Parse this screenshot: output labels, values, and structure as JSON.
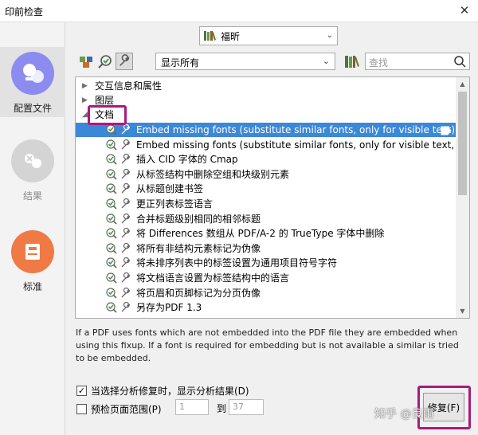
{
  "window": {
    "title": "印前检查",
    "close_glyph": "✕"
  },
  "nav": {
    "items": [
      {
        "label": "配置文件",
        "icon": "profile-icon",
        "color": "#8c8cf0",
        "active": true
      },
      {
        "label": "结果",
        "icon": "results-icon",
        "color": "#d4d4d4",
        "active": false
      },
      {
        "label": "标准",
        "icon": "standards-icon",
        "color": "#f07a45",
        "active": false
      }
    ]
  },
  "profile": {
    "selected": "福昕"
  },
  "toolbar": {
    "filter_value": "显示所有",
    "search_placeholder": "查找"
  },
  "tree": {
    "groups": [
      {
        "label": "交互信息和属性",
        "expanded": false
      },
      {
        "label": "图层",
        "expanded": false
      },
      {
        "label": "文档",
        "expanded": true
      }
    ],
    "items": [
      {
        "label": "Embed missing fonts (substitute similar fonts, only for visible text)",
        "selected": true
      },
      {
        "label": "Embed missing fonts (substitute similar fonts, only for visible text, current and embedded",
        "selected": false
      },
      {
        "label": "插入 CID 字体的 Cmap",
        "selected": false
      },
      {
        "label": "从标签结构中删除空组和块级别元素",
        "selected": false
      },
      {
        "label": "从标题创建书签",
        "selected": false
      },
      {
        "label": "更正列表标签语言",
        "selected": false
      },
      {
        "label": "合并标题级别相同的相邻标题",
        "selected": false
      },
      {
        "label": "将 Differences 数组从 PDF/A-2 的 TrueType 字体中删除",
        "selected": false
      },
      {
        "label": "将所有非结构元素标记为伪像",
        "selected": false
      },
      {
        "label": "将未排序列表中的标签设置为通用项目符号字符",
        "selected": false
      },
      {
        "label": "将文档语言设置为标签结构中的语言",
        "selected": false
      },
      {
        "label": "将页眉和页脚标记为分页伪像",
        "selected": false
      },
      {
        "label": "另存为PDF 1.3",
        "selected": false
      }
    ]
  },
  "description": "If a PDF uses fonts which are not embedded into the PDF file they are embedded when using this fixup. If a font is required for embedding but is not available a similar is tried to be embedded.",
  "options": {
    "show_results_label": "当选择分析修复时，显示分析结果(D)",
    "show_results_checked": true,
    "page_range_label": "预检页面范围(P)",
    "page_range_checked": false,
    "page_from": "1",
    "to_label": "到",
    "page_to": "37"
  },
  "fix_button_label": "修复(F)",
  "watermark": "知乎 @良雨",
  "colors": {
    "selection": "#3b88d8",
    "highlight": "#a81b7e",
    "check_green": "#3a9a3a"
  }
}
